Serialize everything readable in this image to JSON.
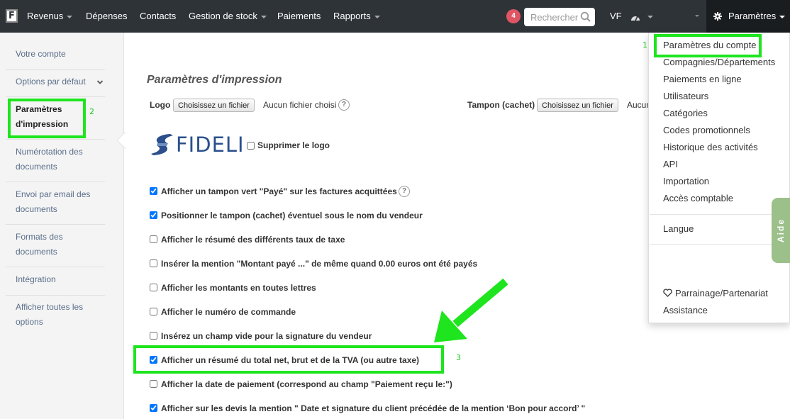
{
  "navbar": {
    "logo_letter": "F",
    "items": [
      "Revenus",
      "Dépenses",
      "Contacts",
      "Gestion de stock",
      "Paiements",
      "Rapports"
    ],
    "notification_count": "4",
    "search_placeholder": "Rechercher",
    "user_initials": "VF",
    "settings_label": "Paramètres"
  },
  "sidebar": {
    "items": [
      "Votre compte",
      "Options par défaut",
      "Paramètres d'impression",
      "Numérotation des documents",
      "Envoi par email des documents",
      "Formats des documents",
      "Intégration",
      "Afficher toutes les options"
    ]
  },
  "main": {
    "title": "Paramètres d'impression",
    "logo_label": "Logo",
    "file_button": "Choisissez un fichier",
    "no_file": "Aucun fichier choisi",
    "help_glyph": "?",
    "stamp_label": "Tampon (cachet)",
    "stamp_no_file": "Aucun",
    "brand_logo_text": "FIDELI",
    "delete_logo_label": "Supprimer le logo",
    "options": [
      {
        "label": "Afficher un tampon vert \"Payé\" sur les factures acquittées",
        "checked": true
      },
      {
        "label": "Positionner le tampon (cachet) éventuel sous le nom du vendeur",
        "checked": true
      },
      {
        "label": "Afficher le résumé des différents taux de taxe",
        "checked": false
      },
      {
        "label": "Insérer la mention \"Montant payé ...\" de même quand 0.00 euros ont été payés",
        "checked": false
      },
      {
        "label": "Afficher les montants en toutes lettres",
        "checked": false
      },
      {
        "label": "Afficher le numéro de commande",
        "checked": false
      },
      {
        "label": "Insérez un champ vide pour la signature du vendeur",
        "checked": false
      },
      {
        "label": "Afficher un résumé du total net, brut et de la TVA (ou autre taxe)",
        "checked": true
      },
      {
        "label": "Afficher la date de paiement (correspond au champ \"Paiement reçu le:\")",
        "checked": false
      },
      {
        "label": "Afficher sur les devis la mention \" Date et signature du client précédée de la mention ‘Bon pour accord’ \"",
        "checked": true
      }
    ]
  },
  "dropdown": {
    "items": [
      "Paramètres du compte",
      "Compagnies/Départements",
      "Paiements en ligne",
      "Utilisateurs",
      "Catégories",
      "Codes promotionnels",
      "Historique des activités",
      "API",
      "Importation",
      "Accès comptable"
    ],
    "language": "Langue",
    "referral": "Parrainage/Partenariat",
    "support": "Assistance"
  },
  "aide_label": "Aide",
  "annotations": [
    "1",
    "2",
    "3"
  ],
  "colors": {
    "navbar": "#2e3338",
    "highlight": "#1ee51e",
    "badge": "#e05564",
    "link": "#5a6e8a",
    "aide": "#9cc08a"
  }
}
